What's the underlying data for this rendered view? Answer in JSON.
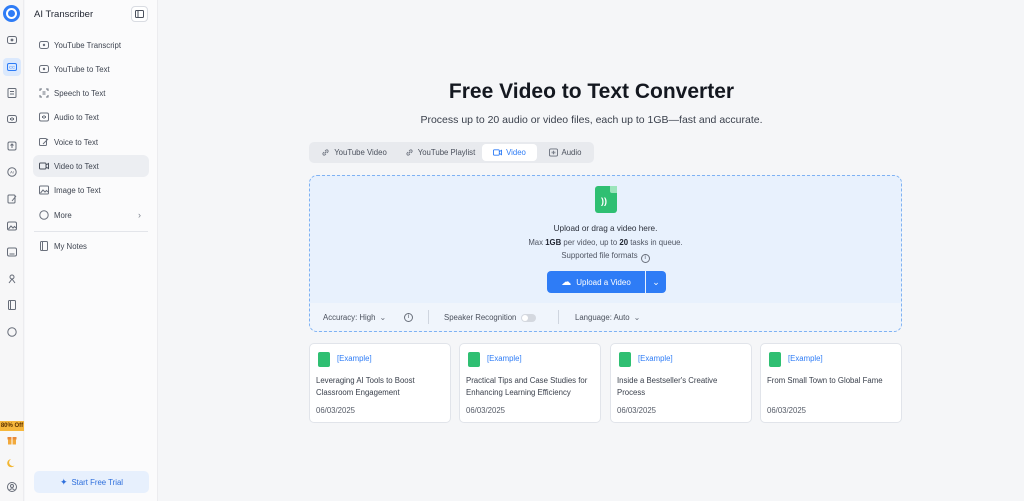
{
  "app": {
    "title": "AI Transcriber",
    "accent": "#2e7cf6"
  },
  "rail": {
    "promo": "80% Off",
    "icons": [
      "video-icon",
      "cc-icon",
      "document-icon",
      "audio-icon",
      "share-icon",
      "ai-icon",
      "edit-icon",
      "image-icon",
      "chart-icon",
      "translate-icon",
      "book-icon",
      "circle-icon",
      "gift-icon",
      "moon-icon",
      "user-icon"
    ]
  },
  "sidebar": {
    "items": [
      {
        "label": "YouTube Transcript",
        "icon": "youtube-icon"
      },
      {
        "label": "YouTube to Text",
        "icon": "youtube-icon"
      },
      {
        "label": "Speech to Text",
        "icon": "speech-icon"
      },
      {
        "label": "Audio to Text",
        "icon": "audio-icon"
      },
      {
        "label": "Voice to Text",
        "icon": "voice-icon"
      },
      {
        "label": "Video to Text",
        "icon": "video-icon"
      },
      {
        "label": "Image to Text",
        "icon": "image-icon"
      },
      {
        "label": "More",
        "icon": "more-icon"
      }
    ],
    "notes": "My Notes",
    "trial": "Start Free Trial"
  },
  "main": {
    "title": "Free Video to Text Converter",
    "subtitle": "Process up to 20 audio or video files, each up to 1GB—fast and accurate.",
    "tabs": [
      {
        "label": "YouTube Video"
      },
      {
        "label": "YouTube Playlist"
      },
      {
        "label": "Video"
      },
      {
        "label": "Audio"
      }
    ],
    "dropzone": {
      "line1": "Upload or drag a video here.",
      "max_prefix": "Max ",
      "max_size": "1GB",
      "max_mid": " per video, up to ",
      "max_count": "20",
      "max_suffix": " tasks in queue.",
      "formats": "Supported file formats",
      "upload": "Upload a Video"
    },
    "options": {
      "accuracy": "Accuracy: High",
      "speaker": "Speaker Recognition",
      "language": "Language: Auto"
    },
    "examples": [
      {
        "tag": "[Example]",
        "title": "Leveraging AI Tools to Boost Classroom Engagement",
        "date": "06/03/2025"
      },
      {
        "tag": "[Example]",
        "title": "Practical Tips and Case Studies for Enhancing Learning Efficiency",
        "date": "06/03/2025"
      },
      {
        "tag": "[Example]",
        "title": "Inside a Bestseller's Creative Process",
        "date": "06/03/2025"
      },
      {
        "tag": "[Example]",
        "title": "From Small Town to Global Fame",
        "date": "06/03/2025"
      }
    ]
  }
}
